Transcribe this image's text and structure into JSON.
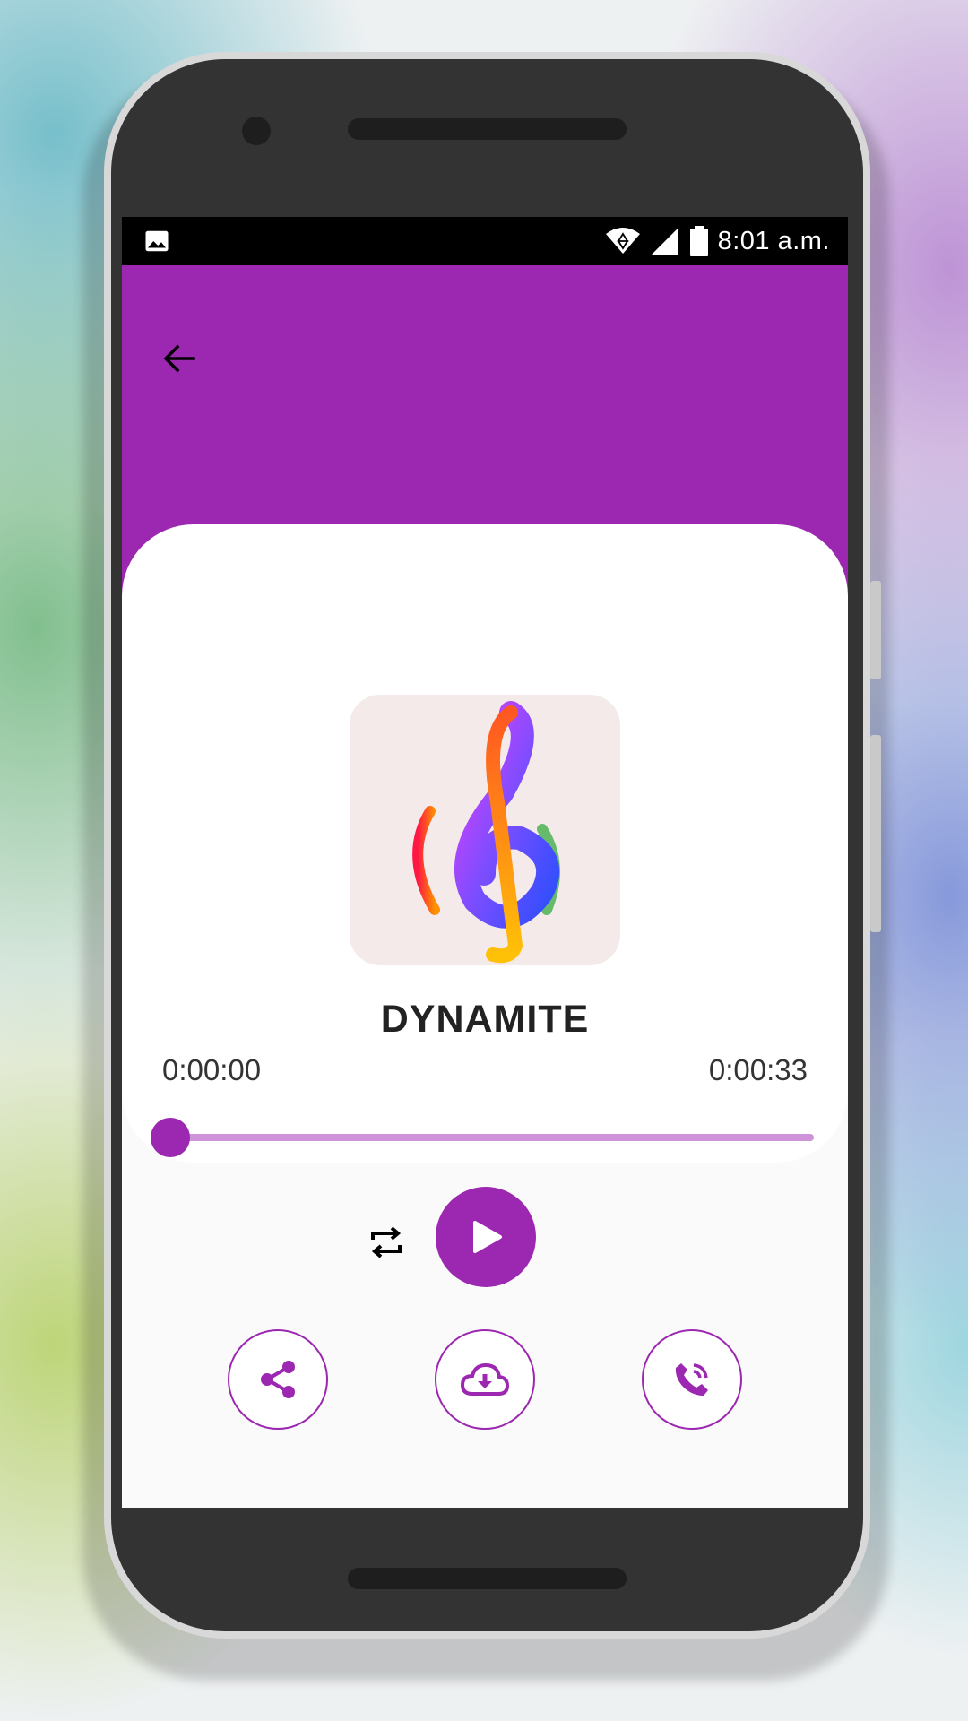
{
  "status_bar": {
    "time": "8:01 a.m.",
    "icons": [
      "image-icon",
      "wifi-icon",
      "cell-signal-icon",
      "battery-icon"
    ]
  },
  "header": {
    "back_icon": "arrow-left-icon",
    "color": "#9c27b0"
  },
  "player": {
    "artwork_icon": "treble-clef-logo",
    "song_title": "DYNAMITE",
    "elapsed": "0:00:00",
    "duration": "0:00:33",
    "progress_fraction": 0,
    "controls": {
      "repeat_icon": "repeat-icon",
      "play_icon": "play-icon"
    },
    "actions": [
      {
        "name": "share",
        "icon": "share-icon"
      },
      {
        "name": "download",
        "icon": "cloud-download-icon"
      },
      {
        "name": "set-ringtone",
        "icon": "phone-ring-icon"
      }
    ]
  },
  "colors": {
    "accent": "#9c27b0",
    "track": "#ce93d8",
    "status_bar": "#000000"
  }
}
